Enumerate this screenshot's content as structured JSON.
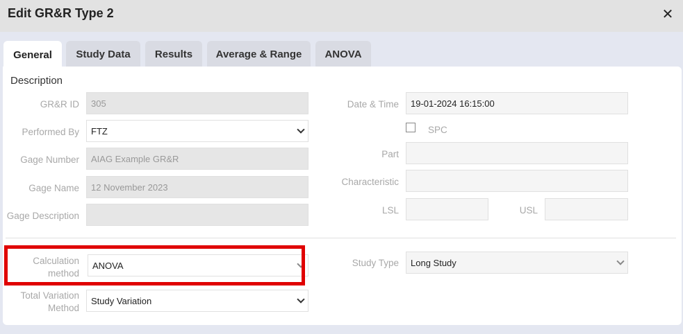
{
  "window": {
    "title": "Edit GR&R Type 2"
  },
  "tabs": [
    {
      "label": "General"
    },
    {
      "label": "Study Data"
    },
    {
      "label": "Results"
    },
    {
      "label": "Average & Range"
    },
    {
      "label": "ANOVA"
    }
  ],
  "active_tab": "General",
  "form": {
    "section_title": "Description",
    "grr_id": {
      "label": "GR&R ID",
      "value": "305"
    },
    "performed_by": {
      "label": "Performed By",
      "value": "FTZ"
    },
    "gage_number": {
      "label": "Gage Number",
      "value": "AIAG Example GR&R"
    },
    "gage_name": {
      "label": "Gage Name",
      "value": "12 November 2023"
    },
    "gage_description": {
      "label": "Gage Description",
      "value": ""
    },
    "date_time": {
      "label": "Date & Time",
      "value": "19-01-2024 16:15:00"
    },
    "spc": {
      "label": "SPC",
      "checked": false
    },
    "part": {
      "label": "Part",
      "value": ""
    },
    "characteristic": {
      "label": "Characteristic",
      "value": ""
    },
    "lsl": {
      "label": "LSL",
      "value": ""
    },
    "usl": {
      "label": "USL",
      "value": ""
    },
    "calculation_method": {
      "label_line1": "Calculation",
      "label_line2": "method",
      "value": "ANOVA"
    },
    "total_variation_method": {
      "label_line1": "Total Variation",
      "label_line2": "Method",
      "value": "Study Variation"
    },
    "study_type": {
      "label": "Study Type",
      "value": "Long Study"
    }
  },
  "colors": {
    "highlight": "#e00000"
  }
}
